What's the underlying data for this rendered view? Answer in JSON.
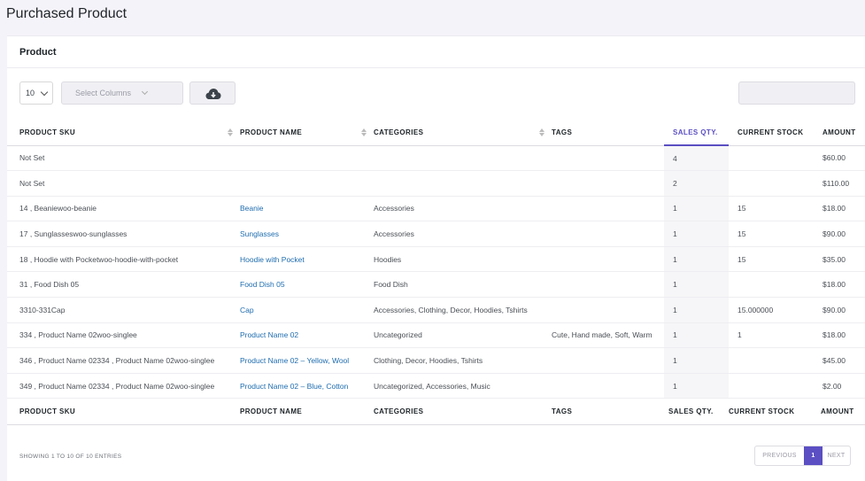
{
  "page": {
    "title": "Purchased Product"
  },
  "card": {
    "title": "Product"
  },
  "toolbar": {
    "page_length": "10",
    "select_columns": "Select Columns",
    "download_icon": "cloud-download-icon",
    "search_value": ""
  },
  "table": {
    "columns": [
      "PRODUCT SKU",
      "PRODUCT NAME",
      "CATEGORIES",
      "TAGS",
      "SALES QTY.",
      "CURRENT STOCK",
      "AMOUNT"
    ],
    "sorted_column": "SALES QTY.",
    "rows": [
      {
        "sku": "Not Set",
        "name": "",
        "categories": "",
        "tags": "",
        "qty": "4",
        "stock": "",
        "amount": "$60.00"
      },
      {
        "sku": "Not Set",
        "name": "",
        "categories": "",
        "tags": "",
        "qty": "2",
        "stock": "",
        "amount": "$110.00"
      },
      {
        "sku": "14 , Beaniewoo-beanie",
        "name": "Beanie",
        "categories": "Accessories",
        "tags": "",
        "qty": "1",
        "stock": "15",
        "amount": "$18.00"
      },
      {
        "sku": "17 , Sunglasseswoo-sunglasses",
        "name": "Sunglasses",
        "categories": "Accessories",
        "tags": "",
        "qty": "1",
        "stock": "15",
        "amount": "$90.00"
      },
      {
        "sku": "18 , Hoodie with Pocketwoo-hoodie-with-pocket",
        "name": "Hoodie with Pocket",
        "categories": "Hoodies",
        "tags": "",
        "qty": "1",
        "stock": "15",
        "amount": "$35.00"
      },
      {
        "sku": "31 , Food Dish 05",
        "name": "Food Dish 05",
        "categories": "Food Dish",
        "tags": "",
        "qty": "1",
        "stock": "",
        "amount": "$18.00"
      },
      {
        "sku": "3310-331Cap",
        "name": "Cap",
        "categories": "Accessories, Clothing, Decor, Hoodies, Tshirts",
        "tags": "",
        "qty": "1",
        "stock": "15.000000",
        "amount": "$90.00"
      },
      {
        "sku": "334 , Product Name 02woo-singlee",
        "name": "Product Name 02",
        "categories": "Uncategorized",
        "tags": "Cute, Hand made, Soft, Warm",
        "qty": "1",
        "stock": "1",
        "amount": "$18.00"
      },
      {
        "sku": "346 , Product Name 02334 , Product Name 02woo-singlee",
        "name": "Product Name 02 – Yellow, Wool",
        "categories": "Clothing, Decor, Hoodies, Tshirts",
        "tags": "",
        "qty": "1",
        "stock": "",
        "amount": "$45.00"
      },
      {
        "sku": "349 , Product Name 02334 , Product Name 02woo-singlee",
        "name": "Product Name 02 – Blue, Cotton",
        "categories": "Uncategorized, Accessories, Music",
        "tags": "",
        "qty": "1",
        "stock": "",
        "amount": "$2.00"
      }
    ]
  },
  "footer": {
    "info": "SHOWING 1 TO 10 OF 10 ENTRIES",
    "prev": "PREVIOUS",
    "current_page": "1",
    "next": "NEXT"
  },
  "colors": {
    "accent": "#5b4fc3",
    "link": "#1f6db0",
    "background": "#f5f3fa"
  }
}
